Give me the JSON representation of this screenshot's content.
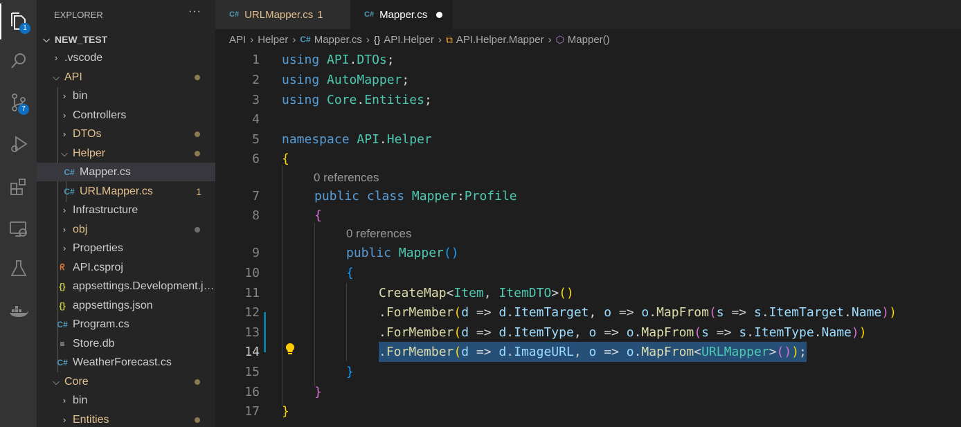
{
  "activity_bar": {
    "explorer_badge": "1",
    "scm_badge": "7"
  },
  "sidebar": {
    "title": "EXPLORER",
    "more_label": "···",
    "tree": [
      {
        "label": "NEW_TEST",
        "chevron": "⌵",
        "icon": ""
      },
      {
        "label": ".vscode",
        "chevron": "›",
        "icon": ""
      },
      {
        "label": "API",
        "chevron": "⌵",
        "icon": ""
      },
      {
        "label": "bin",
        "chevron": "›",
        "icon": ""
      },
      {
        "label": "Controllers",
        "chevron": "›",
        "icon": ""
      },
      {
        "label": "DTOs",
        "chevron": "›",
        "icon": ""
      },
      {
        "label": "Helper",
        "chevron": "⌵",
        "icon": ""
      },
      {
        "label": "Mapper.cs",
        "chevron": "",
        "icon": "C#"
      },
      {
        "label": "URLMapper.cs",
        "chevron": "",
        "icon": "C#",
        "count": "1"
      },
      {
        "label": "Infrastructure",
        "chevron": "›",
        "icon": ""
      },
      {
        "label": "obj",
        "chevron": "›",
        "icon": ""
      },
      {
        "label": "Properties",
        "chevron": "›",
        "icon": ""
      },
      {
        "label": "API.csproj",
        "chevron": "",
        "icon": "rss-icon"
      },
      {
        "label": "appsettings.Development.json",
        "chevron": "",
        "icon": "{}"
      },
      {
        "label": "appsettings.json",
        "chevron": "",
        "icon": "{}"
      },
      {
        "label": "Program.cs",
        "chevron": "",
        "icon": "C#"
      },
      {
        "label": "Store.db",
        "chevron": "",
        "icon": "≡"
      },
      {
        "label": "WeatherForecast.cs",
        "chevron": "",
        "icon": "C#"
      },
      {
        "label": "Core",
        "chevron": "⌵",
        "icon": ""
      },
      {
        "label": "bin",
        "chevron": "›",
        "icon": ""
      },
      {
        "label": "Entities",
        "chevron": "›",
        "icon": ""
      }
    ]
  },
  "tabs": [
    {
      "label": "URLMapper.cs",
      "problems": "1"
    },
    {
      "label": "Mapper.cs"
    }
  ],
  "breadcrumb": {
    "items": [
      "API",
      "Helper",
      "Mapper.cs",
      "API.Helper",
      "API.Helper.Mapper",
      "Mapper()"
    ],
    "separator": "›"
  },
  "editor": {
    "line_numbers": [
      "1",
      "2",
      "3",
      "4",
      "5",
      "6",
      "7",
      "8",
      "9",
      "10",
      "11",
      "12",
      "13",
      "14",
      "15",
      "16",
      "17"
    ],
    "codelens": [
      "0 references",
      "0 references"
    ],
    "tokens": {
      "using": "using",
      "api_dtos_api": "API",
      "dot": ".",
      "api_dtos_dtos": "DTOs",
      "semi": ";",
      "automapper": "AutoMapper",
      "core": "Core",
      "entities": "Entities",
      "namespace": "namespace",
      "api": "API",
      "helper": "Helper",
      "lbrace": "{",
      "rbrace": "}",
      "public": "public",
      "class": "class",
      "mapper": "Mapper",
      "colon": ":",
      "profile": "Profile",
      "mapper_ctor": "Mapper",
      "lparen": "(",
      "rparen": ")",
      "createmap": "CreateMap",
      "lt": "<",
      "gt": ">",
      "item": "Item",
      "comma": ", ",
      "itemdto": "ItemDTO",
      "formember": "ForMember",
      "d": "d",
      "arrow": " => ",
      "itemtarget": "ItemTarget",
      "o": "o",
      "mapfrom": "MapFrom",
      "s": "s",
      "name": "Name",
      "itemtype": "ItemType",
      "imageurl": "ImageURL",
      "urlmapper": "URLMapper"
    }
  }
}
